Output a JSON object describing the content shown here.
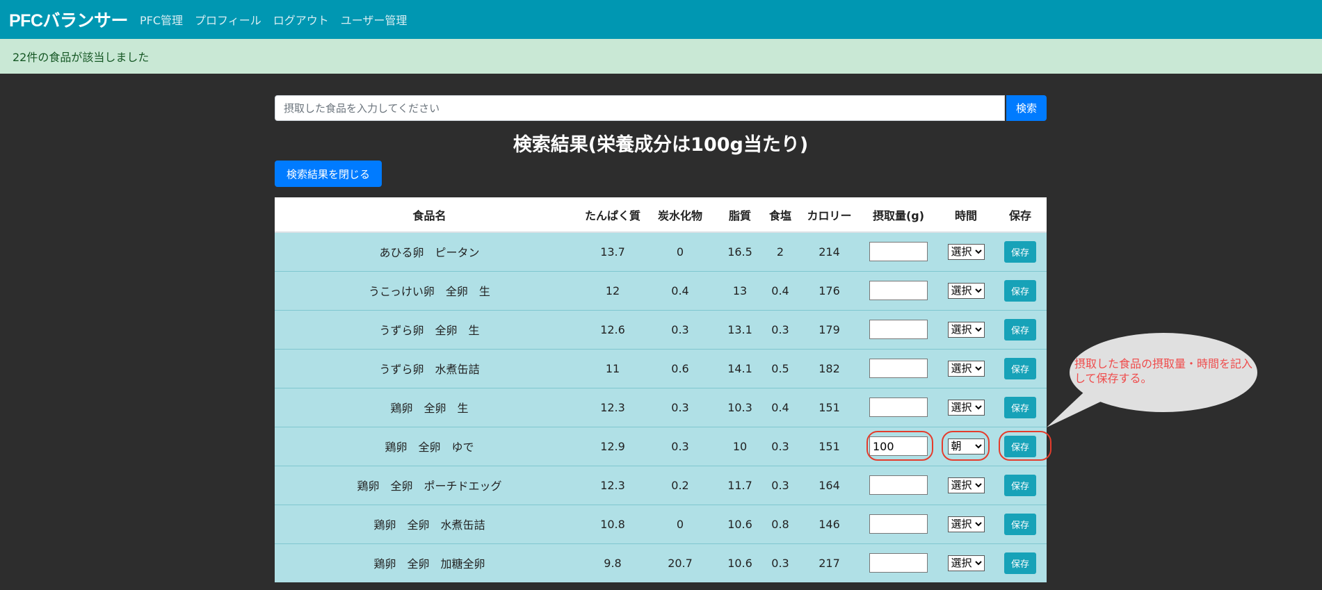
{
  "nav": {
    "brand": "PFCバランサー",
    "items": [
      "PFC管理",
      "プロフィール",
      "ログアウト",
      "ユーザー管理"
    ]
  },
  "alert": {
    "message": "22件の食品が該当しました"
  },
  "search": {
    "placeholder": "摂取した食品を入力してください",
    "button_label": "検索"
  },
  "results": {
    "title": "検索結果(栄養成分は100g当たり)",
    "close_label": "検索結果を閉じる",
    "columns": [
      "食品名",
      "たんぱく質",
      "炭水化物",
      "脂質",
      "食塩",
      "カロリー",
      "摂取量(g)",
      "時間",
      "保存"
    ],
    "rows": [
      {
        "name": "あひる卵　ピータン",
        "protein": "13.7",
        "carbs": "0",
        "fat": "16.5",
        "salt": "2",
        "calories": "214",
        "qty": "",
        "time": "選択",
        "save": "保存"
      },
      {
        "name": "うこっけい卵　全卵　生",
        "protein": "12",
        "carbs": "0.4",
        "fat": "13",
        "salt": "0.4",
        "calories": "176",
        "qty": "",
        "time": "選択",
        "save": "保存"
      },
      {
        "name": "うずら卵　全卵　生",
        "protein": "12.6",
        "carbs": "0.3",
        "fat": "13.1",
        "salt": "0.3",
        "calories": "179",
        "qty": "",
        "time": "選択",
        "save": "保存"
      },
      {
        "name": "うずら卵　水煮缶詰",
        "protein": "11",
        "carbs": "0.6",
        "fat": "14.1",
        "salt": "0.5",
        "calories": "182",
        "qty": "",
        "time": "選択",
        "save": "保存"
      },
      {
        "name": "鶏卵　全卵　生",
        "protein": "12.3",
        "carbs": "0.3",
        "fat": "10.3",
        "salt": "0.4",
        "calories": "151",
        "qty": "",
        "time": "選択",
        "save": "保存"
      },
      {
        "name": "鶏卵　全卵　ゆで",
        "protein": "12.9",
        "carbs": "0.3",
        "fat": "10",
        "salt": "0.3",
        "calories": "151",
        "qty": "100",
        "time": "朝",
        "save": "保存"
      },
      {
        "name": "鶏卵　全卵　ポーチドエッグ",
        "protein": "12.3",
        "carbs": "0.2",
        "fat": "11.7",
        "salt": "0.3",
        "calories": "164",
        "qty": "",
        "time": "選択",
        "save": "保存"
      },
      {
        "name": "鶏卵　全卵　水煮缶詰",
        "protein": "10.8",
        "carbs": "0",
        "fat": "10.6",
        "salt": "0.8",
        "calories": "146",
        "qty": "",
        "time": "選択",
        "save": "保存"
      },
      {
        "name": "鶏卵　全卵　加糖全卵",
        "protein": "9.8",
        "carbs": "20.7",
        "fat": "10.6",
        "salt": "0.3",
        "calories": "217",
        "qty": "",
        "time": "選択",
        "save": "保存"
      }
    ]
  },
  "callout": {
    "text": "摂取した食品の摂取量・時間を記入して保存する。"
  },
  "colors": {
    "navbar": "#0097b2",
    "alert_bg": "#c9e8d5",
    "row_bg": "#b0e0e6",
    "primary": "#007bff",
    "save": "#17a2b8",
    "annotation": "#e43c2c"
  }
}
